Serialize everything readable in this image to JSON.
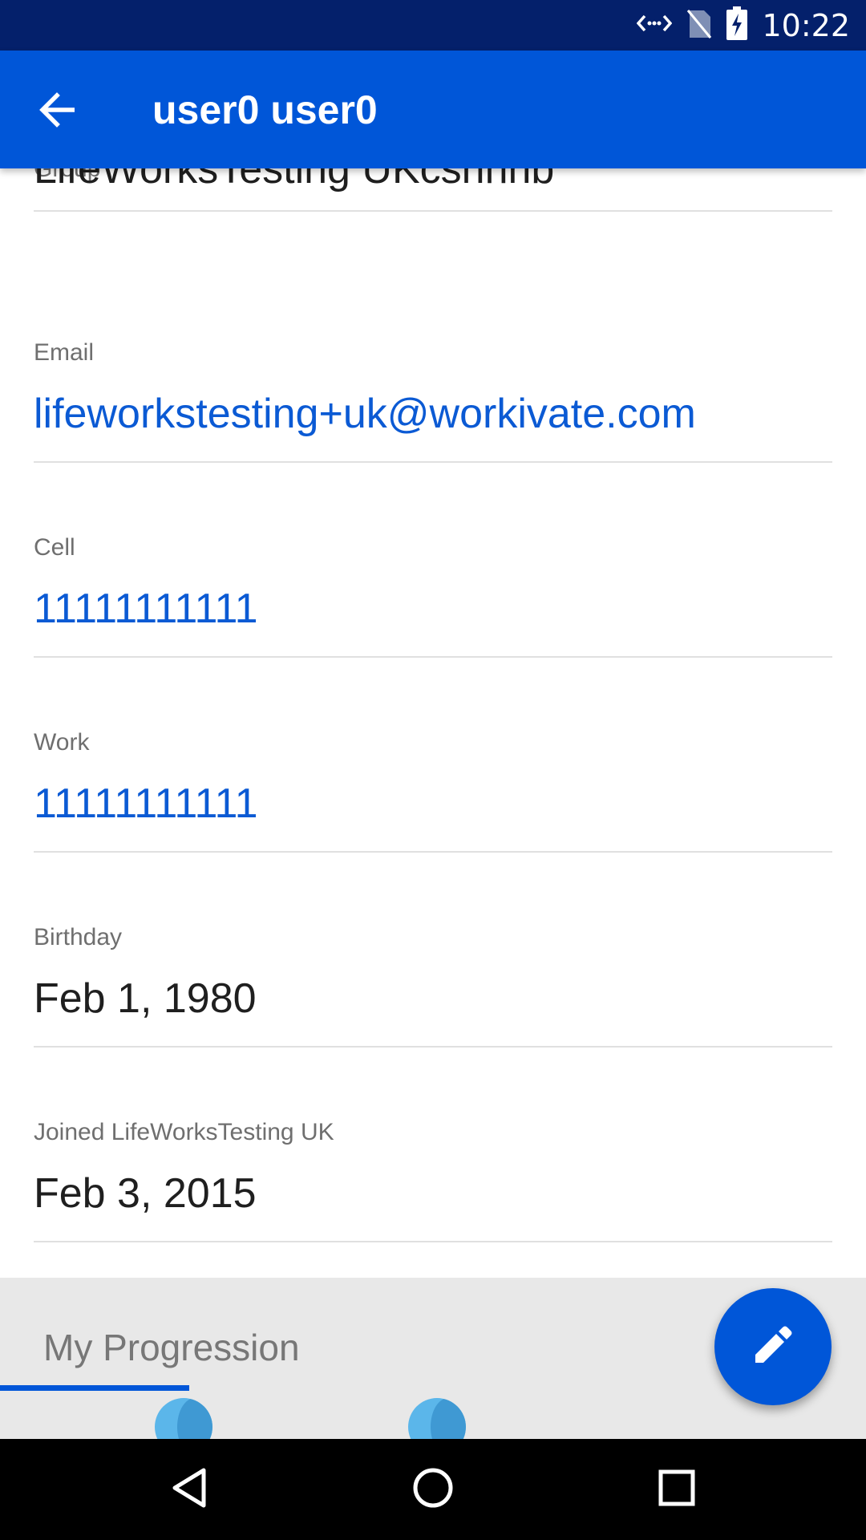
{
  "status_bar": {
    "time": "10:22",
    "icons": [
      "data-sync-icon",
      "no-sim-icon",
      "battery-charging-icon"
    ]
  },
  "app_bar": {
    "title": "user0 user0",
    "back_icon": "arrow-back-icon"
  },
  "profile": {
    "group": {
      "label": "Group",
      "value": "LifeWorksTesting UKcsnhnb"
    },
    "email": {
      "label": "Email",
      "value": "lifeworkstesting+uk@workivate.com"
    },
    "cell": {
      "label": "Cell",
      "value": "11111111111"
    },
    "work": {
      "label": "Work",
      "value": "11111111111"
    },
    "birthday": {
      "label": "Birthday",
      "value": "Feb 1, 1980"
    },
    "joined": {
      "label": "Joined LifeWorksTesting UK",
      "value": "Feb 3, 2015"
    }
  },
  "progression": {
    "title": "My Progression"
  },
  "fab": {
    "icon": "pencil-edit-icon"
  },
  "nav_bar": {
    "icons": [
      "back-triangle-icon",
      "home-circle-icon",
      "recents-square-icon"
    ]
  },
  "colors": {
    "status_bar": "#04206b",
    "primary": "#0056d8",
    "link": "#0b5ad4",
    "panel": "#e8e8e8"
  }
}
